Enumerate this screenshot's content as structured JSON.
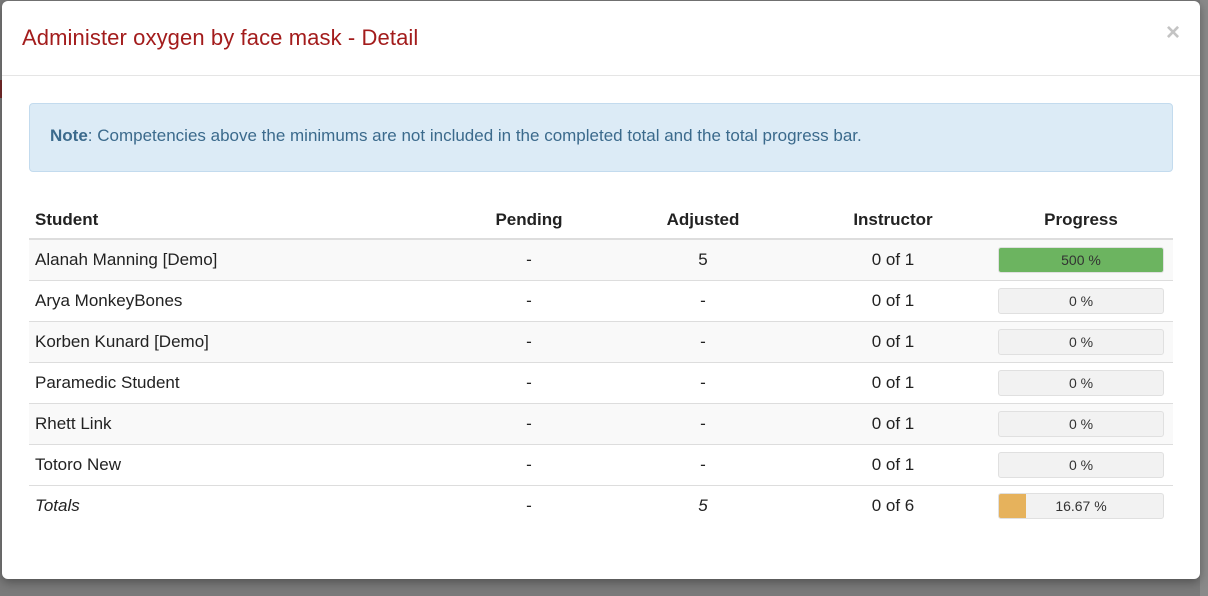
{
  "modal": {
    "title": "Administer oxygen by face mask - Detail",
    "close_label": "×"
  },
  "note": {
    "label": "Note",
    "text": ": Competencies above the minimums are not included in the completed total and the total progress bar."
  },
  "table": {
    "headers": {
      "student": "Student",
      "pending": "Pending",
      "adjusted": "Adjusted",
      "instructor": "Instructor",
      "progress": "Progress"
    },
    "rows": [
      {
        "student": "Alanah Manning [Demo]",
        "pending": "-",
        "adjusted": "5",
        "instructor": "0 of 1",
        "progress_label": "500 %",
        "progress_value": 5.0,
        "bar_color": "#6cb460"
      },
      {
        "student": "Arya MonkeyBones",
        "pending": "-",
        "adjusted": "-",
        "instructor": "0 of 1",
        "progress_label": "0 %",
        "progress_value": 0
      },
      {
        "student": "Korben Kunard [Demo]",
        "pending": "-",
        "adjusted": "-",
        "instructor": "0 of 1",
        "progress_label": "0 %",
        "progress_value": 0
      },
      {
        "student": "Paramedic Student",
        "pending": "-",
        "adjusted": "-",
        "instructor": "0 of 1",
        "progress_label": "0 %",
        "progress_value": 0
      },
      {
        "student": "Rhett Link",
        "pending": "-",
        "adjusted": "-",
        "instructor": "0 of 1",
        "progress_label": "0 %",
        "progress_value": 0
      },
      {
        "student": "Totoro New",
        "pending": "-",
        "adjusted": "-",
        "instructor": "0 of 1",
        "progress_label": "0 %",
        "progress_value": 0
      }
    ],
    "totals": {
      "student": "Totals",
      "pending": "-",
      "adjusted": "5",
      "instructor": "0 of 6",
      "progress_label": "16.67 %",
      "progress_value": 0.1667,
      "bar_color": "#e6b25c"
    }
  },
  "colors": {
    "title": "#a31c1c",
    "note_bg": "#dcebf6",
    "note_text": "#3b6a8c"
  }
}
